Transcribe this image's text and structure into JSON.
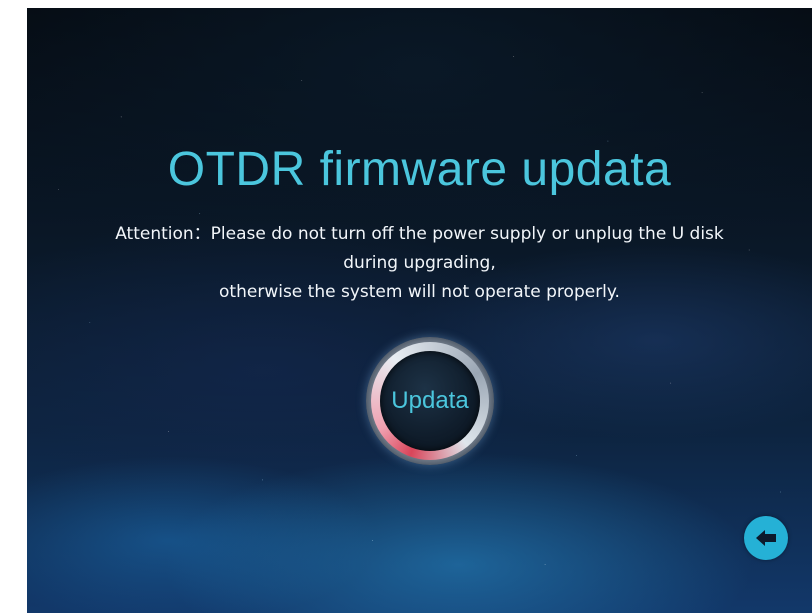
{
  "screen": {
    "title": "OTDR firmware updata",
    "attention_lines": [
      "Attention：Please do not turn off the power supply or unplug the U disk",
      "during upgrading,",
      "otherwise the system will not operate properly."
    ]
  },
  "update_button": {
    "label": "Updata"
  },
  "back_button": {
    "icon": "back-arrow-icon"
  },
  "colors": {
    "accent": "#4bc6dd",
    "back_button": "#25b1d6"
  }
}
